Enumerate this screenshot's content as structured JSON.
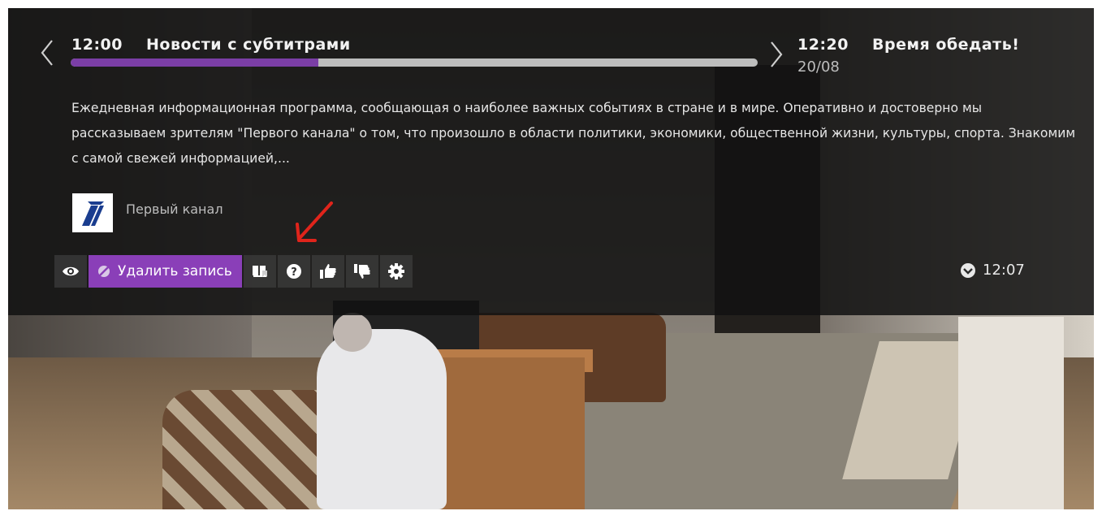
{
  "current_program": {
    "time": "12:00",
    "title": "Новости с субтитрами",
    "progress": 0.36
  },
  "next_program": {
    "time": "12:20",
    "title": "Время обедать!",
    "date": "20/08"
  },
  "description": "Ежедневная информационная программа, сообщающая о наиболее важных событиях в стране и в мире. Оперативно и достоверно мы рассказываем зрителям \"Первого канала\" о том, что произошло в области политики, экономики, общественной жизни, культуры, спорта. Знакомим с самой свежей информацией,...",
  "channel": {
    "name": "Первый канал",
    "logo_icon": "first-channel-logo"
  },
  "toolbar": {
    "delete_label": "Удалить запись",
    "buttons": [
      "eye-icon",
      "delete-record-button",
      "book-icon",
      "help-icon",
      "thumbs-up-icon",
      "thumbs-down-icon",
      "gear-icon"
    ]
  },
  "status": {
    "time": "12:07",
    "icon": "chevron-down-circle-icon"
  },
  "colors": {
    "accent": "#8a3fb8",
    "progress": "#7b3ea6",
    "annotation_arrow": "#e0241b"
  }
}
